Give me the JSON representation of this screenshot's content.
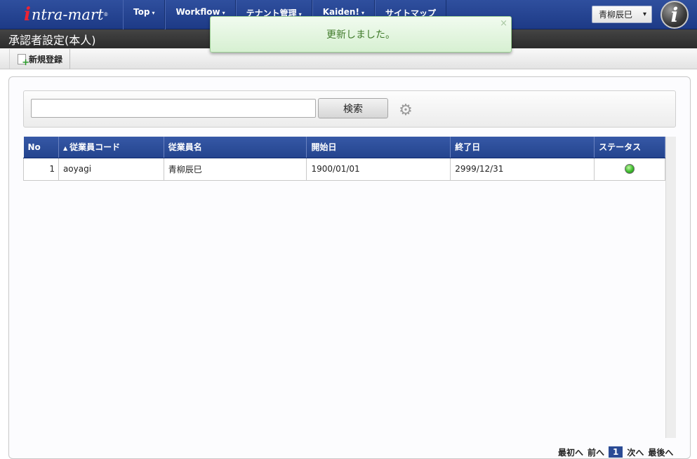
{
  "brand": {
    "logo_i": "i",
    "logo_text": "ntra-mart",
    "logo_mark": "®"
  },
  "nav": [
    {
      "label": "Top",
      "caret": "▾"
    },
    {
      "label": "Workflow",
      "caret": "▾"
    },
    {
      "label": "テナント管理",
      "caret": "▾"
    },
    {
      "label": "Kaiden!",
      "caret": "▾"
    },
    {
      "label": "サイトマップ",
      "caret": ""
    }
  ],
  "user": {
    "name": "青柳辰巳",
    "caret": "▾"
  },
  "info_button": {
    "glyph": "i"
  },
  "page_title": "承認者設定(本人)",
  "toolbar": {
    "new_label": "新規登録"
  },
  "toast": {
    "message": "更新しました。",
    "close": "×"
  },
  "search": {
    "placeholder": "",
    "value": "",
    "button_label": "検索",
    "settings_glyph": "⚙"
  },
  "table": {
    "sort_indicator": "▲",
    "columns": [
      "No",
      "従業員コード",
      "従業員名",
      "開始日",
      "終了日",
      "ステータス"
    ],
    "rows": [
      {
        "no": "1",
        "code": "aoyagi",
        "name": "青柳辰巳",
        "start": "1900/01/01",
        "end": "2999/12/31",
        "status": "active"
      }
    ]
  },
  "pager": {
    "first": "最初へ",
    "prev": "前へ",
    "current": "1",
    "next": "次へ",
    "last": "最後へ"
  }
}
